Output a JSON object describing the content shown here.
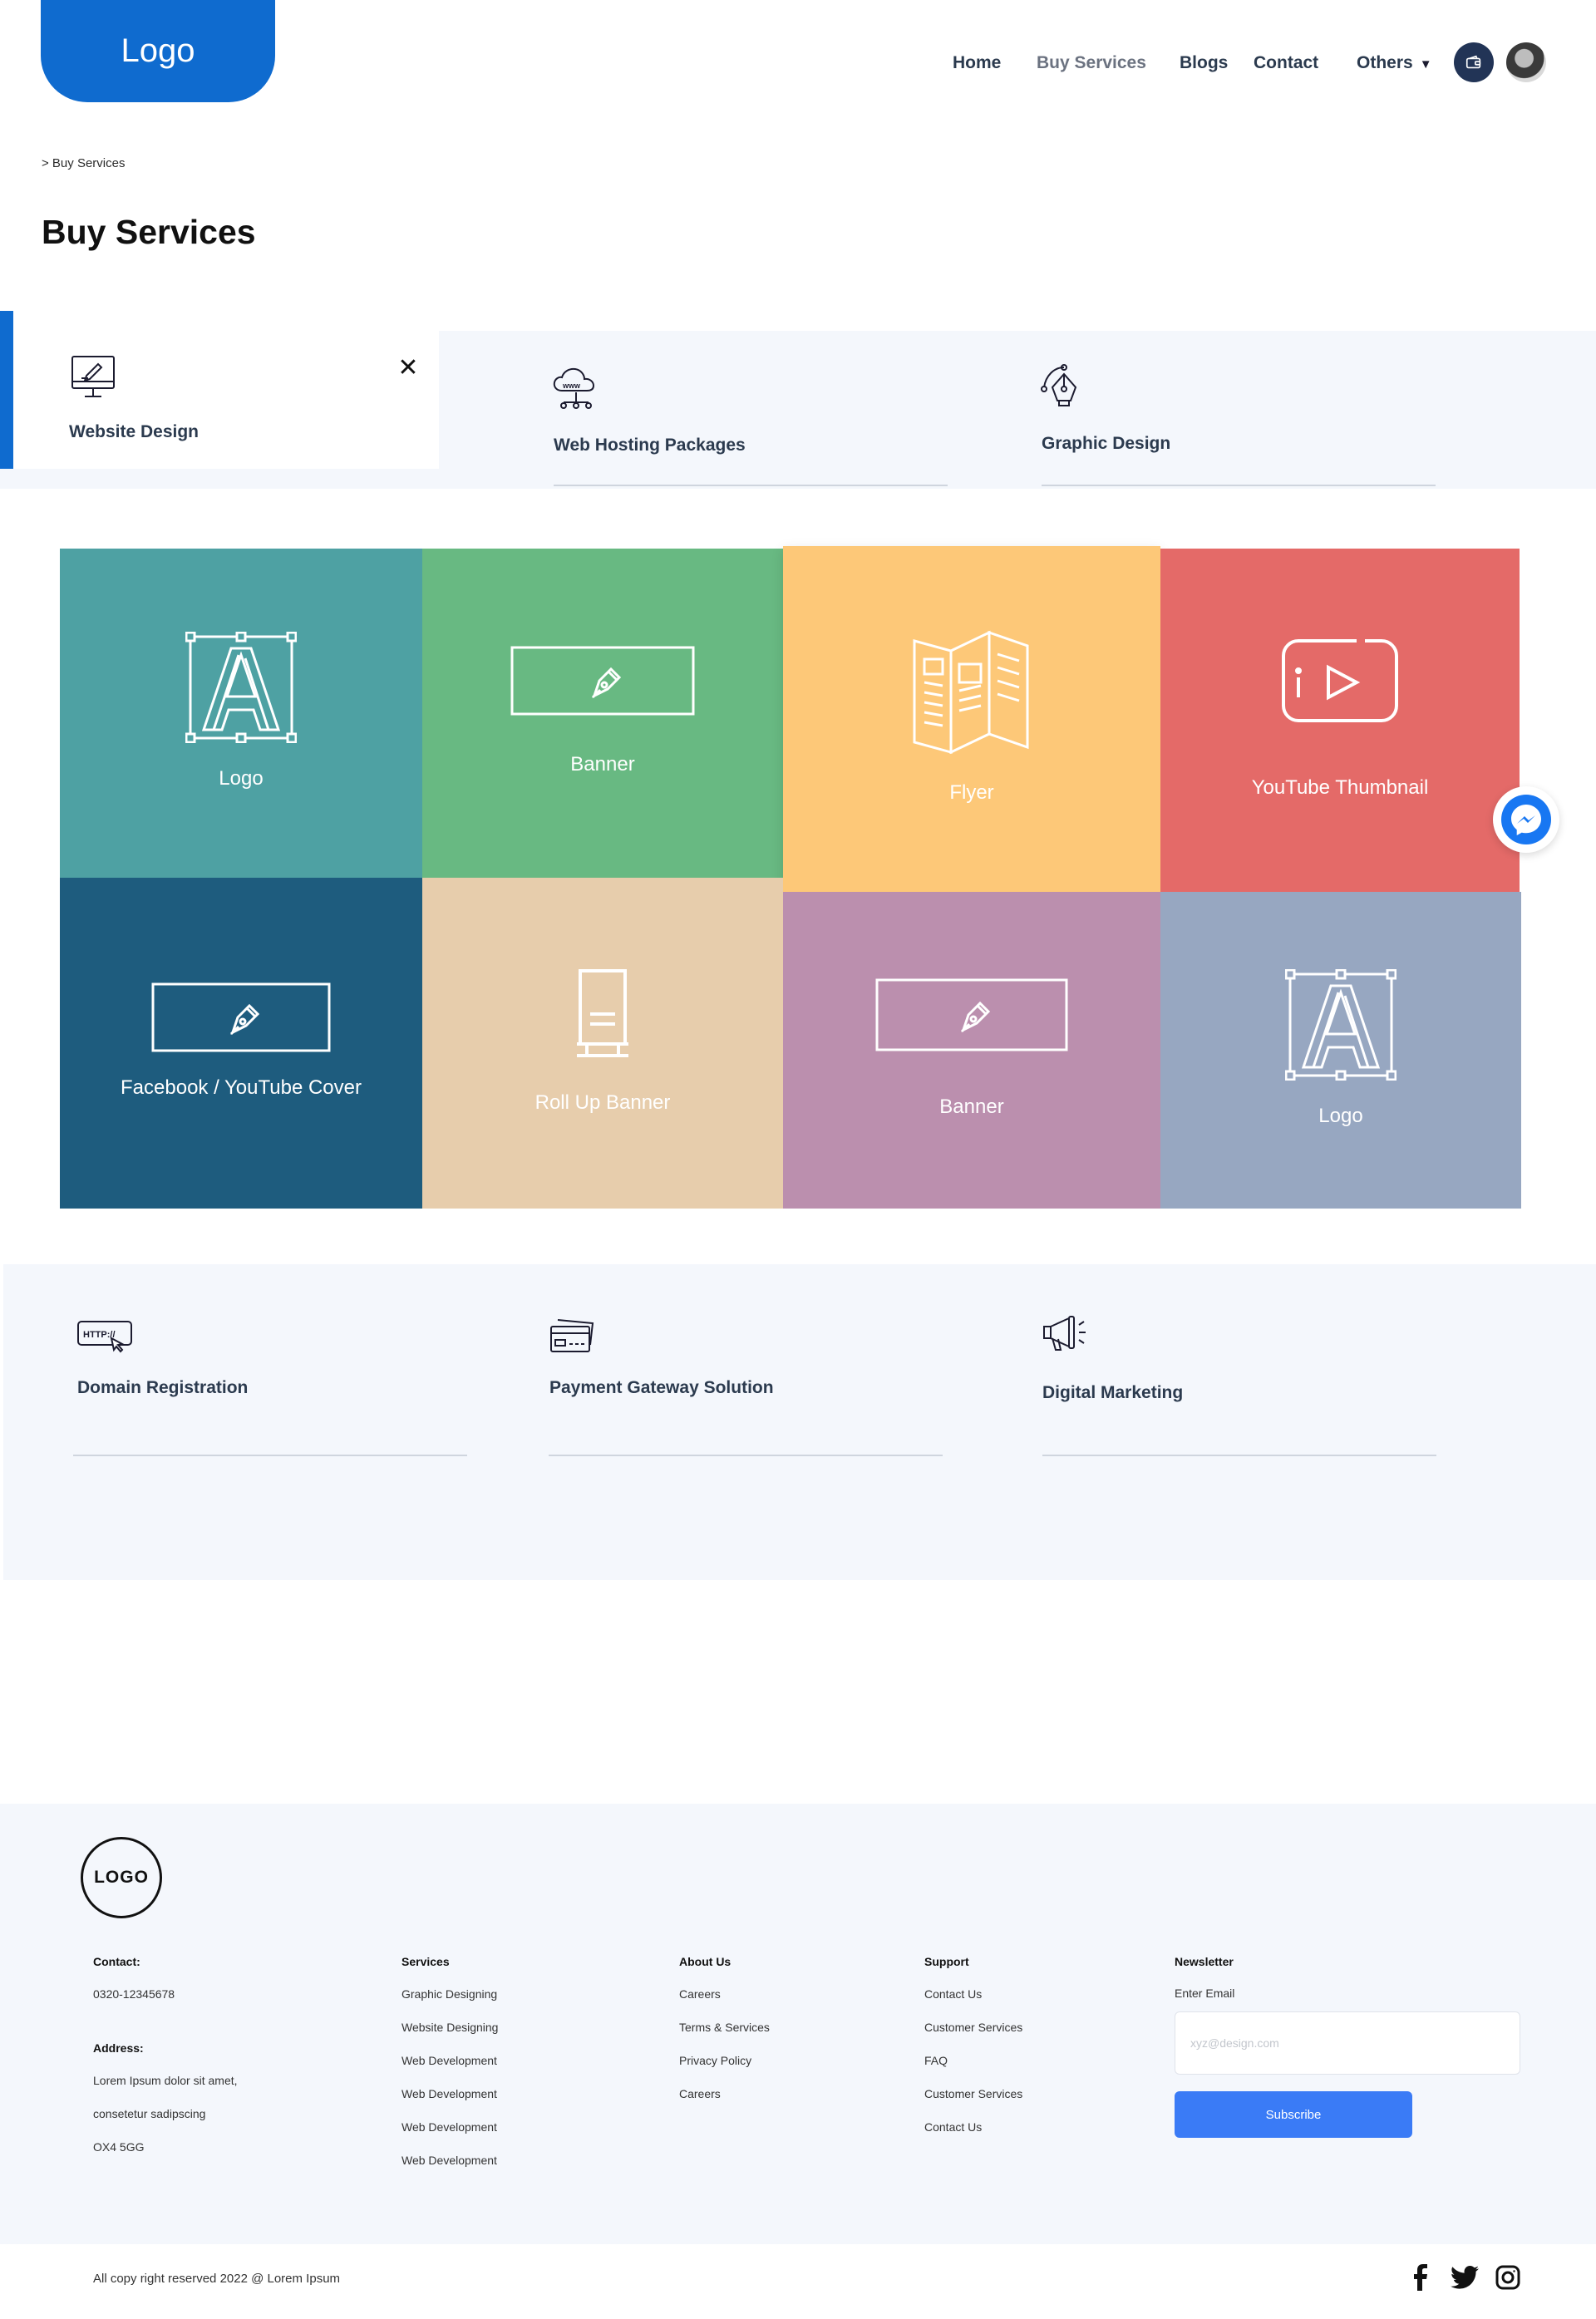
{
  "header": {
    "logo": "Logo",
    "nav": [
      {
        "label": "Home"
      },
      {
        "label": "Buy Services"
      },
      {
        "label": "Blogs"
      },
      {
        "label": "Contact"
      },
      {
        "label": "Others"
      }
    ],
    "wallet_icon": "wallet-icon",
    "avatar_icon": "user-avatar"
  },
  "breadcrumb": "> Buy Services",
  "page_title": "Buy Services",
  "top_tabs": [
    {
      "label": "Website Design",
      "icon": "monitor-pen-icon",
      "active": true
    },
    {
      "label": "Web Hosting Packages",
      "icon": "cloud-www-icon"
    },
    {
      "label": "Graphic Design",
      "icon": "pen-tool-icon"
    }
  ],
  "tiles": [
    {
      "label": "Logo",
      "icon": "logo-letter-icon",
      "color": "#4ea1a3"
    },
    {
      "label": "Banner",
      "icon": "banner-pen-icon",
      "color": "#68b982"
    },
    {
      "label": "Flyer",
      "icon": "flyer-icon",
      "color": "#fdc878"
    },
    {
      "label": "YouTube Thumbnail",
      "icon": "youtube-icon",
      "color": "#e46a68"
    },
    {
      "label": "Facebook / YouTube Cover",
      "icon": "banner-pen-icon",
      "color": "#1e5c7e"
    },
    {
      "label": "Roll Up Banner",
      "icon": "rollup-icon",
      "color": "#e7cdac"
    },
    {
      "label": "Banner",
      "icon": "banner-pen-icon",
      "color": "#bb8fae"
    },
    {
      "label": "Logo",
      "icon": "logo-letter-icon",
      "color": "#97a7c1"
    }
  ],
  "bottom_services": [
    {
      "label": "Domain Registration",
      "icon": "http-icon"
    },
    {
      "label": "Payment Gateway Solution",
      "icon": "credit-card-icon"
    },
    {
      "label": "Digital Marketing",
      "icon": "megaphone-icon"
    }
  ],
  "messenger_icon": "messenger-icon",
  "footer": {
    "logo": "LOGO",
    "contact": {
      "title": "Contact:",
      "phone": "0320-12345678",
      "address_title": "Address:",
      "address_lines": [
        "Lorem Ipsum dolor sit amet,",
        "consetetur sadipscing",
        "OX4 5GG"
      ]
    },
    "services": {
      "title": "Services",
      "items": [
        "Graphic Designing",
        "Website Designing",
        "Web Development",
        "Web Development",
        "Web Development",
        "Web Development"
      ]
    },
    "about": {
      "title": "About Us",
      "items": [
        "Careers",
        "Terms & Services",
        "Privacy Policy",
        "Careers"
      ]
    },
    "support": {
      "title": "Support",
      "items": [
        "Contact Us",
        "Customer Services",
        "FAQ",
        "Customer Services",
        "Contact Us"
      ]
    },
    "newsletter": {
      "title": "Newsletter",
      "label": "Enter Email",
      "placeholder": "xyz@design.com",
      "button": "Subscribe"
    },
    "copyright": "All copy right reserved 2022 @ Lorem Ipsum",
    "social": [
      "facebook-icon",
      "twitter-icon",
      "instagram-icon"
    ]
  }
}
